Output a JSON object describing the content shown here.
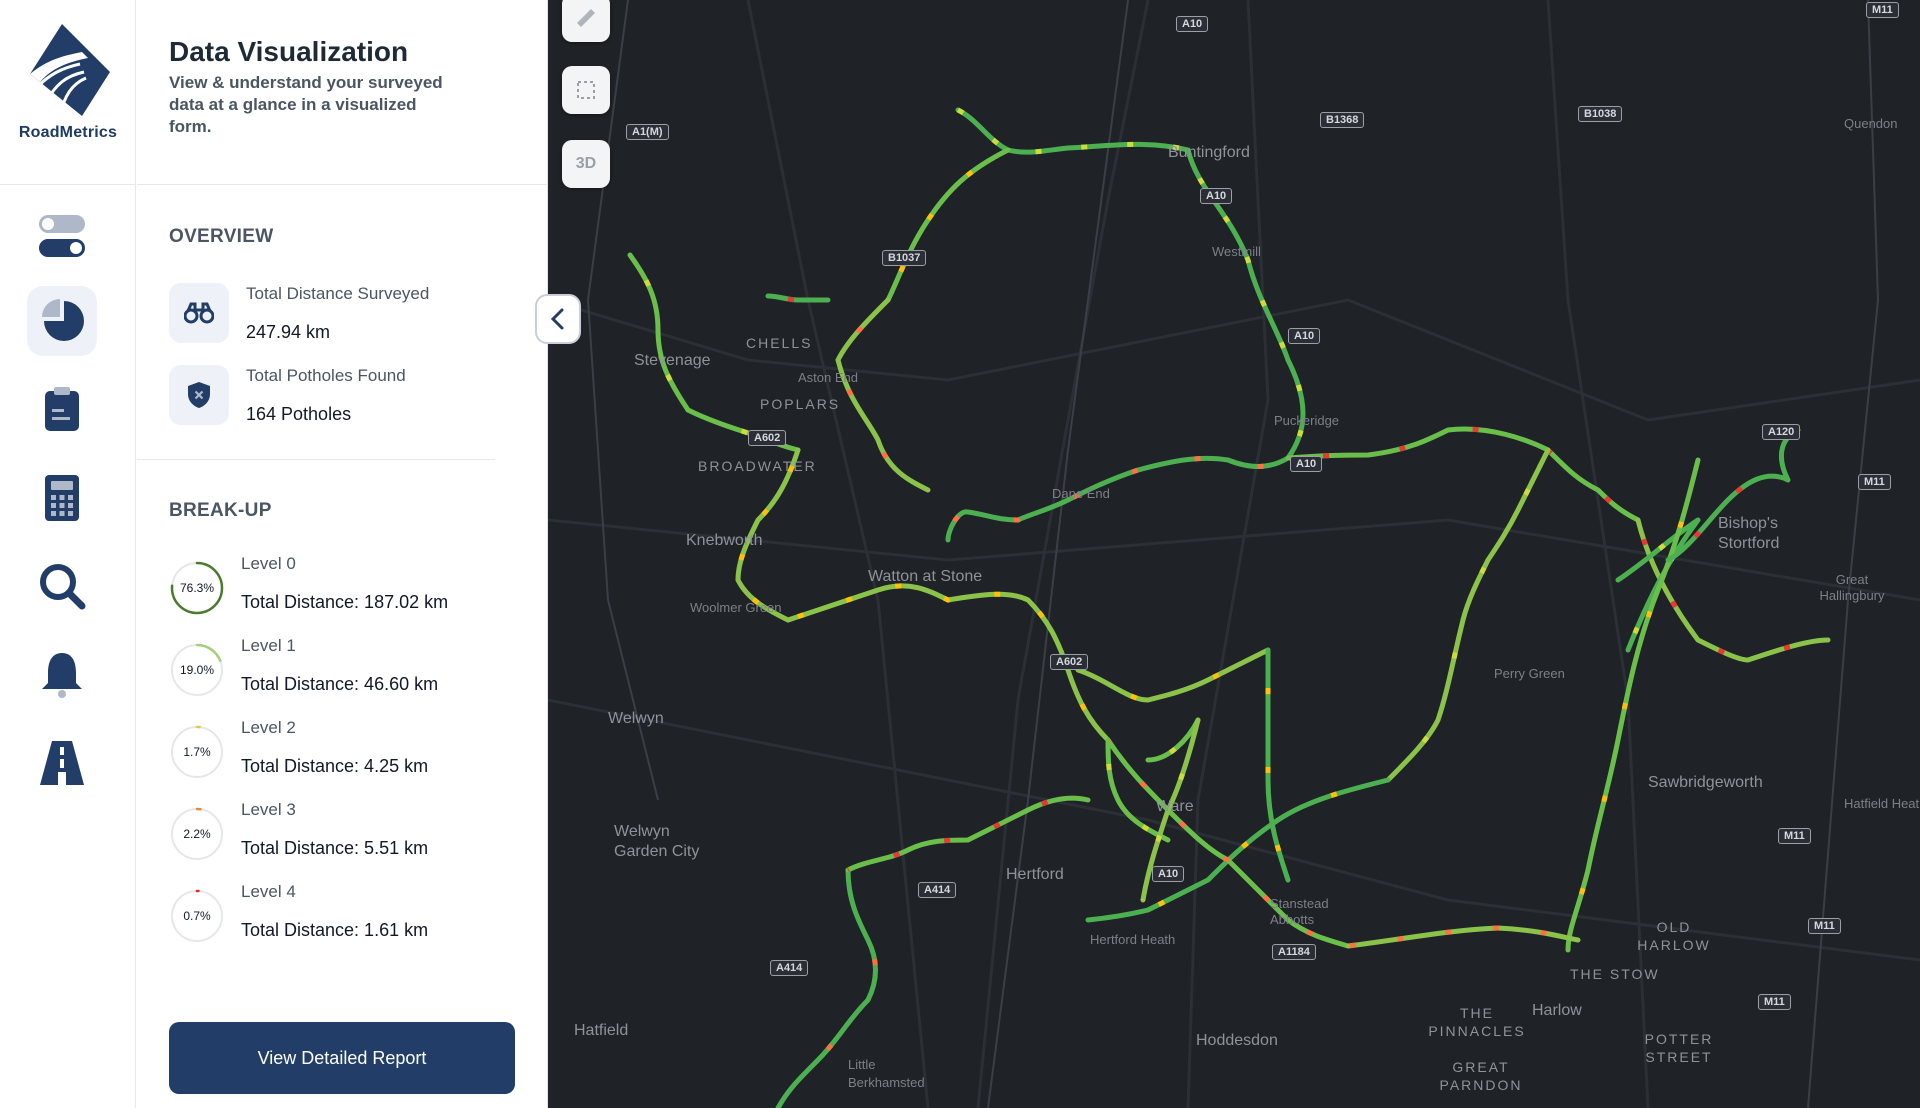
{
  "brand": {
    "name": "RoadMetrics"
  },
  "header": {
    "title": "Data Visualization",
    "subtitle": "View & understand your surveyed data at a glance in a visualized form."
  },
  "rail": [
    {
      "icon": "toggle-icon",
      "active": false
    },
    {
      "icon": "pie-chart-icon",
      "active": true
    },
    {
      "icon": "clipboard-icon",
      "active": false
    },
    {
      "icon": "calculator-icon",
      "active": false
    },
    {
      "icon": "search-icon",
      "active": false
    },
    {
      "icon": "bell-icon",
      "active": false
    },
    {
      "icon": "road-icon",
      "active": false
    }
  ],
  "overview": {
    "title": "OVERVIEW",
    "distance_label": "Total Distance Surveyed",
    "distance_value": "247.94 km",
    "potholes_label": "Total Potholes Found",
    "potholes_value": "164 Potholes"
  },
  "breakup": {
    "title": "BREAK-UP",
    "levels": [
      {
        "name": "Level 0",
        "pct": "76.3%",
        "fraction": 0.763,
        "distance": "Total Distance: 187.02 km",
        "color": "#4a7a2c"
      },
      {
        "name": "Level 1",
        "pct": "19.0%",
        "fraction": 0.19,
        "distance": "Total Distance: 46.60 km",
        "color": "#a6cf7a"
      },
      {
        "name": "Level 2",
        "pct": "1.7%",
        "fraction": 0.017,
        "distance": "Total Distance: 4.25 km",
        "color": "#e6c94a"
      },
      {
        "name": "Level 3",
        "pct": "2.2%",
        "fraction": 0.022,
        "distance": "Total Distance: 5.51 km",
        "color": "#e88a3a"
      },
      {
        "name": "Level 4",
        "pct": "0.7%",
        "fraction": 0.007,
        "distance": "Total Distance: 1.61 km",
        "color": "#d6322b"
      }
    ]
  },
  "report_button": "View Detailed Report",
  "map": {
    "controls": {
      "ruler": "ruler-icon",
      "select": "select-icon",
      "three_d": "3D"
    },
    "places": [
      "Stevenage",
      "CHELLS",
      "Aston End",
      "POPLARS",
      "BROADWATER",
      "Knebworth",
      "Woolmer Green",
      "Watton at Stone",
      "Welwyn",
      "Welwyn Garden City",
      "Hertford",
      "Hertford Heath",
      "Hatfield",
      "Little Berkhamsted",
      "Hoddesdon",
      "Stanstead Abbotts",
      "Ware",
      "Dane End",
      "Puckeridge",
      "Westmill",
      "Buntingford",
      "Quendon",
      "Great Hallingbury",
      "Bishop's Stortford",
      "Perry Green",
      "Sawbridgeworth",
      "Hatfield Heath",
      "OLD HARLOW",
      "THE STOW",
      "Harlow",
      "THE PINNACLES",
      "GREAT PARNDON",
      "POTTER STREET"
    ],
    "roads": [
      "A10",
      "A1(M)",
      "B1368",
      "B1038",
      "B1037",
      "A602",
      "A414",
      "M11",
      "A120",
      "A1184"
    ]
  }
}
